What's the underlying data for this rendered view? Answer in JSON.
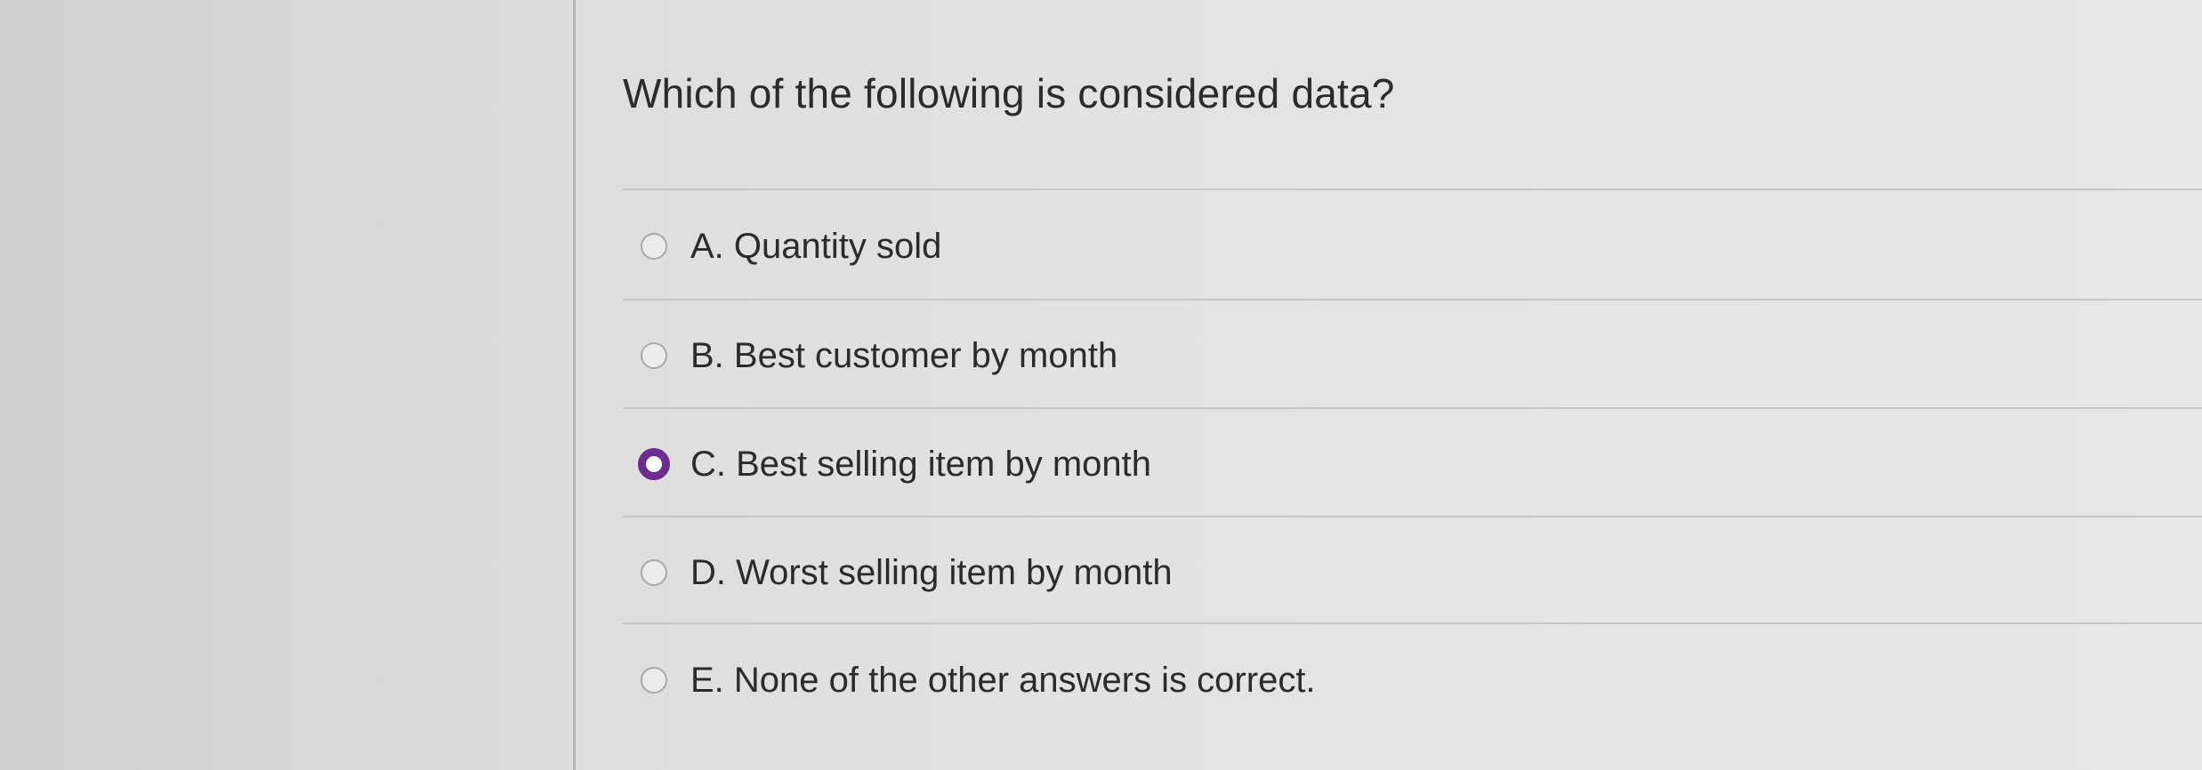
{
  "question": {
    "text": "Which of the following is considered data?"
  },
  "options": [
    {
      "label": "A. Quantity sold",
      "selected": false
    },
    {
      "label": "B. Best customer by month",
      "selected": false
    },
    {
      "label": "C. Best selling item by month",
      "selected": true
    },
    {
      "label": "D. Worst selling item by month",
      "selected": false
    },
    {
      "label": "E. None of the other answers is correct.",
      "selected": false
    }
  ],
  "colors": {
    "selected_radio": "#6b2d8f",
    "text": "#2b2b2b",
    "background": "#e4e4e2"
  }
}
